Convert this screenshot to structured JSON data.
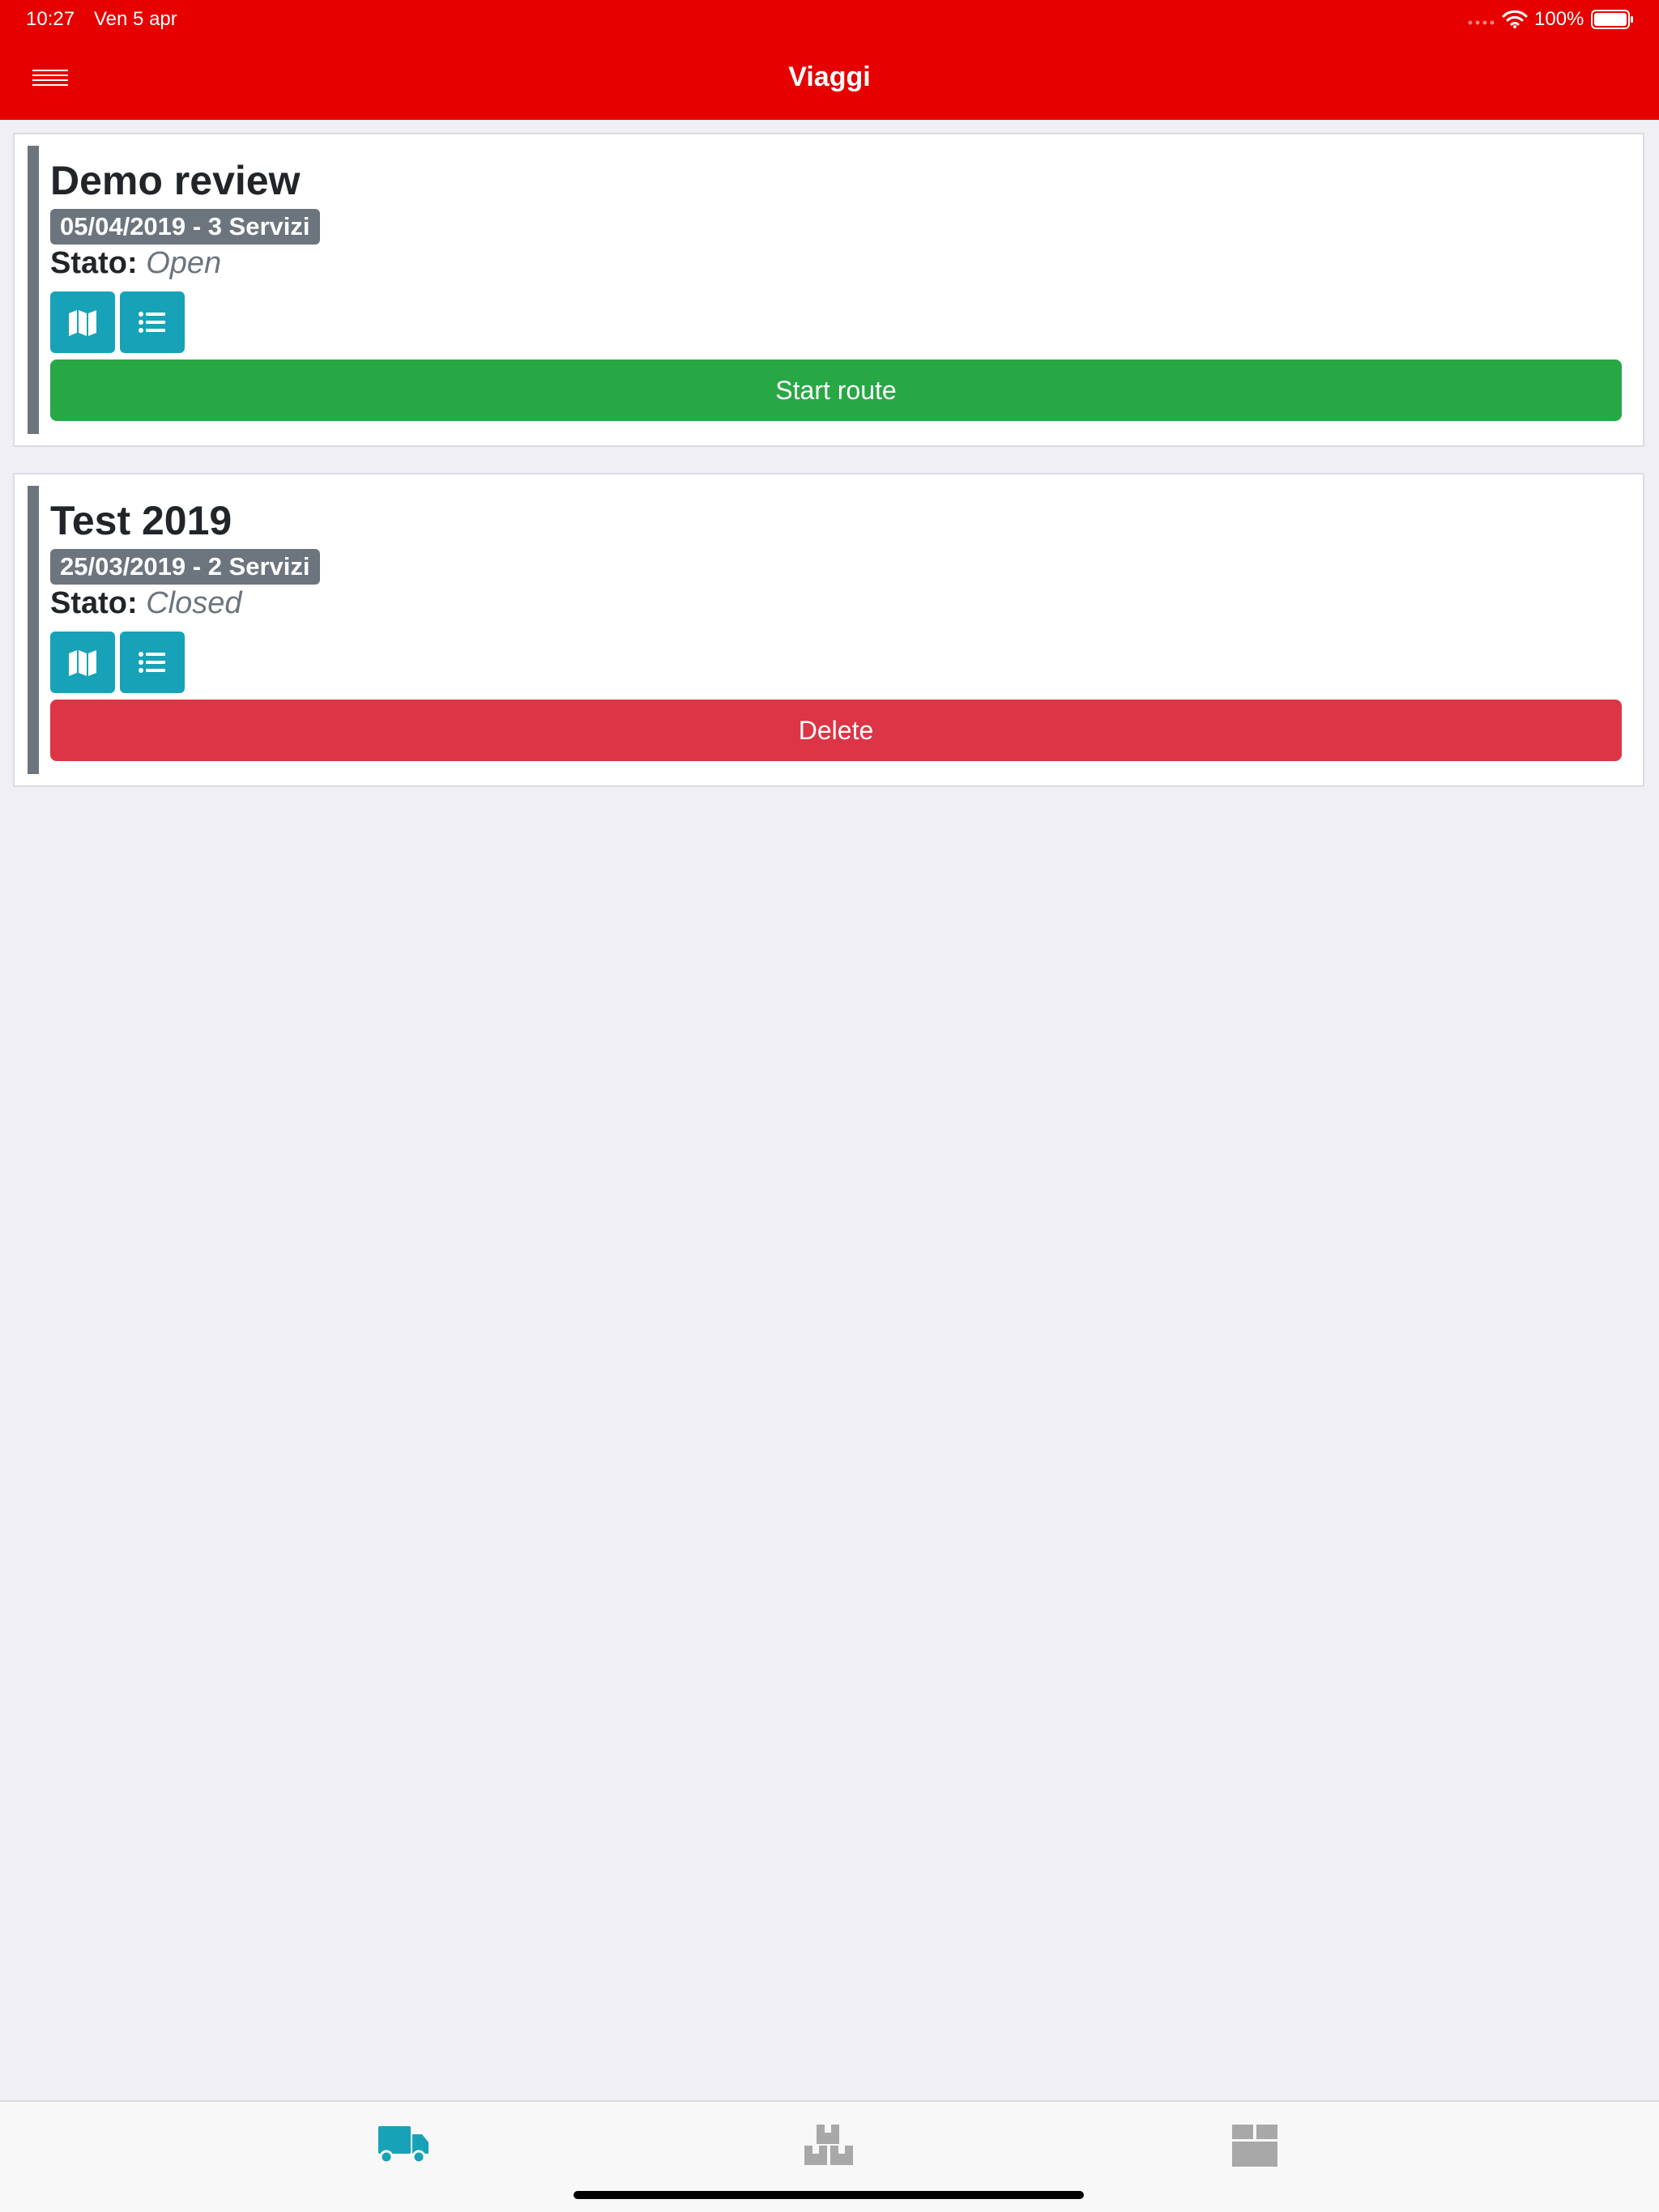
{
  "status_bar": {
    "time": "10:27",
    "date": "Ven 5 apr",
    "battery": "100%"
  },
  "nav": {
    "title": "Viaggi",
    "menu_icon": "hamburger-menu-icon"
  },
  "trips": [
    {
      "name": "Demo review",
      "badge": "05/04/2019 - 3 Servizi",
      "state_label": "Stato:",
      "state_value": "Open",
      "action_label": "Start route",
      "action_color": "#28a745"
    },
    {
      "name": "Test 2019",
      "badge": "25/03/2019 - 2 Servizi",
      "state_label": "Stato:",
      "state_value": "Closed",
      "action_label": "Delete",
      "action_color": "#dc3545"
    }
  ],
  "tabs": [
    {
      "icon": "truck-icon",
      "active": true
    },
    {
      "icon": "boxes-icon",
      "active": false
    },
    {
      "icon": "box-icon",
      "active": false
    }
  ],
  "colors": {
    "header": "#e60000",
    "badge": "#6c757d",
    "icon_button": "#17a2b8",
    "tab_active": "#17a2b8",
    "tab_inactive": "#a8a8a8"
  }
}
